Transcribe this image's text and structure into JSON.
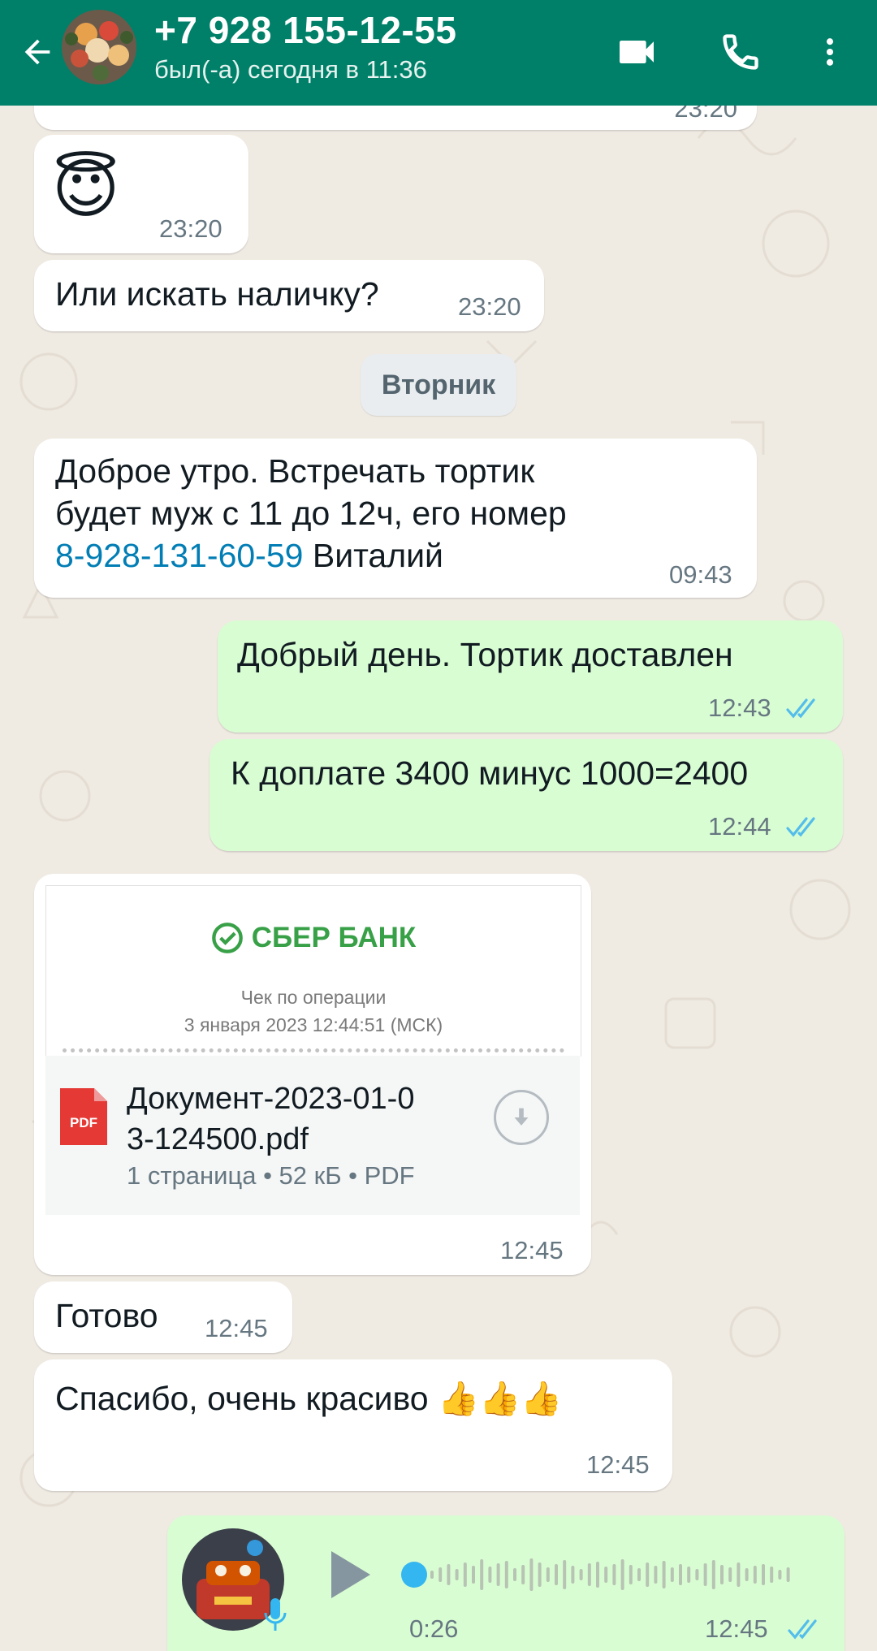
{
  "header": {
    "title": "+7 928 155-12-55",
    "status": "был(-а) сегодня в 11:36",
    "back_icon": "arrow-left-icon",
    "video_icon": "video-camera-icon",
    "call_icon": "phone-icon",
    "menu_icon": "more-vertical-icon"
  },
  "colors": {
    "header": "#008069",
    "chat_bg": "#efeae2",
    "incoming": "#ffffff",
    "outgoing": "#d9fdd3",
    "link": "#027eb5",
    "read_ticks": "#53bdeb"
  },
  "messages": {
    "partial_time": "23:20",
    "emoji": {
      "text": "😇",
      "time": "23:20"
    },
    "cash": {
      "text": "Или искать наличку?",
      "time": "23:20"
    },
    "date_divider": "Вторник",
    "morning": {
      "line1": "Доброе утро. Встречать тортик",
      "line2": "будет муж с 11 до 12ч, его номер",
      "phone": "8-928-131-60-59",
      "name": " Виталий",
      "time": "09:43"
    },
    "delivered": {
      "text": "Добрый день.  Тортик доставлен",
      "time": "12:43",
      "status": "read"
    },
    "payment": {
      "text": "К доплате 3400 минус 1000=2400",
      "time": "12:44",
      "status": "read"
    },
    "document": {
      "bank": "СБЕР БАНК",
      "receipt_title": "Чек по операции",
      "receipt_date": "3 января 2023 12:44:51 (МСК)",
      "file_icon": "PDF",
      "file_name_line1": "Документ-2023-01-0",
      "file_name_line2": "3-124500.pdf",
      "file_meta": "1 страница • 52 кБ • PDF",
      "time": "12:45"
    },
    "done": {
      "text": "Готово",
      "time": "12:45"
    },
    "thanks": {
      "text": "Спасибо, очень красиво 👍👍👍",
      "time": "12:45"
    },
    "voice": {
      "duration": "0:26",
      "time": "12:45",
      "status": "read",
      "progress": 0
    }
  }
}
